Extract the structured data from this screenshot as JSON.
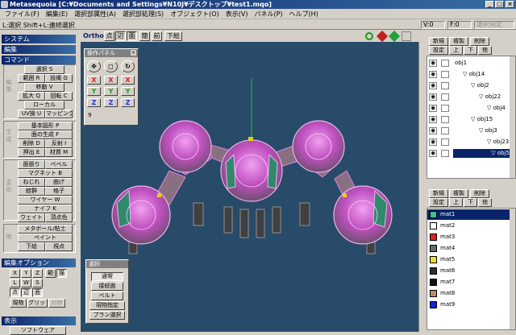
{
  "window": {
    "title": "Metasequoia [C:¥Documents and Settings¥N10J¥デスクトップ¥test1.mqo]",
    "controls": [
      "_",
      "□",
      "×"
    ]
  },
  "menu": [
    "ファイル(F)",
    "編集(E)",
    "選択部属性(A)",
    "選択部処理(S)",
    "オブジェクト(O)",
    "表示(V)",
    "パネル(P)",
    "ヘルプ(H)"
  ],
  "status": {
    "hint": "L:選択  Shift+L:連続選択",
    "v": "V:0",
    "f": "F:0",
    "fixed": "選択固定"
  },
  "left": {
    "system": "システム",
    "edit": "編集",
    "command": "コマンド",
    "select_label": "選択 S",
    "range": "範囲 R",
    "lasso": "投縄 G",
    "move": "移動 V",
    "scale": "拡大 Q",
    "rotate": "回転 C",
    "local": "ローカル",
    "uv": "UV操 U",
    "mapping": "マッピング",
    "basic_shape": "基本図形 P",
    "face_gen": "面の生成 F",
    "delete": "削除 D",
    "knife_x": "反射 I",
    "extrude": "押出 E",
    "material_m": "材質 M",
    "surface_cut": "面張り",
    "bevel": "ベベル",
    "magnet": "マグネット B",
    "twist": "ねじれ",
    "bend": "曲げ",
    "bulge": "蛙群",
    "lattice": "格子",
    "wire": "ワイヤー W",
    "knife": "ナイフ K",
    "weight": "ウェイト",
    "vertex_color": "頂点色",
    "metaball": "メタボール/粘土",
    "paint": "ペイント",
    "bottom": "下絵",
    "viewpoint": "視点",
    "cat_edit": "編集",
    "cat_create": "生成",
    "cat_deform": "変形",
    "cat_other": "他",
    "edit_options": "編集オプション",
    "x": "X",
    "y": "Y",
    "z": "Z",
    "range2": "範",
    "draw": "描",
    "l": "L",
    "w": "W",
    "s": "S",
    "point": "点",
    "edge": "辺",
    "face": "面",
    "current": "現物",
    "grid": "グリッド",
    "symmetry": "対称",
    "display": "表示",
    "software": "ソフトウェア"
  },
  "viewtoolbar": {
    "ortho": "Ortho",
    "point": "点",
    "edge": "辺",
    "face": "面",
    "persp": "簡",
    "front": "前",
    "bottom": "下絵"
  },
  "op_panel": {
    "title": "操作パネル",
    "x": "X",
    "y": "Y",
    "z": "Z",
    "value": "9"
  },
  "select_panel": {
    "title": "選択",
    "normal": "通常",
    "connected": "接続面",
    "belt": "ベルト",
    "current": "現物指定",
    "plan": "プラン選択"
  },
  "objects": {
    "new": "新規",
    "copy": "複製",
    "delete": "削除",
    "settings": "設定",
    "up": "上",
    "down": "下",
    "other": "他",
    "items": [
      {
        "name": "obj1",
        "indent": 0,
        "selected": false
      },
      {
        "name": "obj14",
        "indent": 1,
        "selected": false
      },
      {
        "name": "obj2",
        "indent": 2,
        "selected": false
      },
      {
        "name": "obj22",
        "indent": 3,
        "selected": false
      },
      {
        "name": "obj4",
        "indent": 4,
        "selected": false
      },
      {
        "name": "obj15",
        "indent": 2,
        "selected": false
      },
      {
        "name": "obj3",
        "indent": 3,
        "selected": false
      },
      {
        "name": "obj23",
        "indent": 4,
        "selected": false
      },
      {
        "name": "obj5",
        "indent": 5,
        "selected": true
      }
    ]
  },
  "materials": {
    "new": "新規",
    "copy": "複製",
    "delete": "削除",
    "settings": "設定",
    "up": "上",
    "down": "下",
    "other": "他",
    "items": [
      {
        "name": "mat1",
        "color": "#3fbf9a",
        "selected": true
      },
      {
        "name": "mat2",
        "color": "#ffffff",
        "selected": false
      },
      {
        "name": "mat3",
        "color": "#e02020",
        "selected": false
      },
      {
        "name": "mat4",
        "color": "#6a6a6a",
        "selected": false
      },
      {
        "name": "mat5",
        "color": "#f0e020",
        "selected": false
      },
      {
        "name": "mat6",
        "color": "#303030",
        "selected": false
      },
      {
        "name": "mat7",
        "color": "#101010",
        "selected": false
      },
      {
        "name": "mat8",
        "color": "#c08860",
        "selected": false
      },
      {
        "name": "mat9",
        "color": "#1020e0",
        "selected": false
      }
    ]
  }
}
